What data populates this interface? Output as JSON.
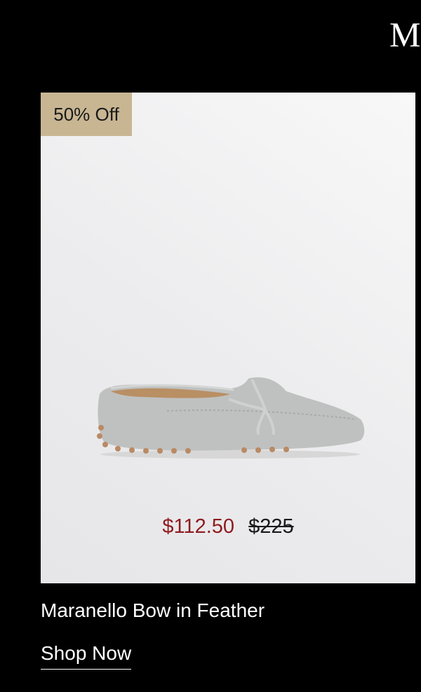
{
  "header": {
    "partial_title": "M"
  },
  "product": {
    "badge": "50% Off",
    "sale_price": "$112.50",
    "original_price": "$225",
    "name": "Maranello Bow in Feather",
    "image_icon": "loafer-shoe-image"
  },
  "cta": {
    "label": "Shop Now"
  },
  "colors": {
    "background": "#000000",
    "badge": "#c8b693",
    "sale_price": "#8e1b1f",
    "shoe": "#bfc1c0"
  }
}
